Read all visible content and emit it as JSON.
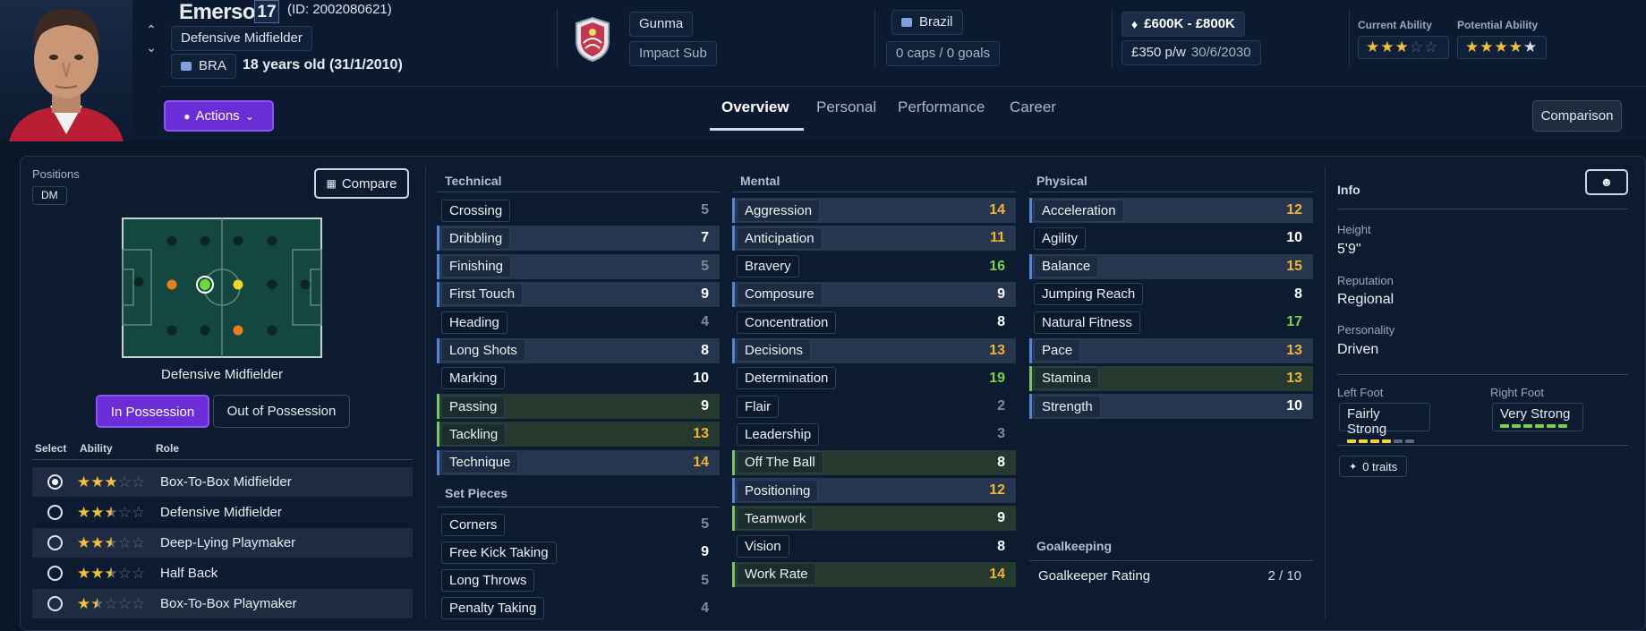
{
  "player": {
    "name": "Emerson",
    "shirt_number": "17",
    "id_text": "(ID: 2002080621)",
    "position_label": "Defensive Midfielder",
    "nationality_code": "BRA",
    "age_text": "18 years old (31/1/2010)"
  },
  "club": {
    "name": "Gunma",
    "squad_status": "Impact Sub"
  },
  "international": {
    "country": "Brazil",
    "caps_goals": "0 caps / 0 goals"
  },
  "contract": {
    "value": "£600K - £800K",
    "wage": "£350 p/w",
    "expiry": "30/6/2030"
  },
  "ability": {
    "current_label": "Current Ability",
    "current_stars": 3,
    "potential_label": "Potential Ability",
    "potential_stars": 5
  },
  "toolbar": {
    "actions_label": "Actions",
    "comparison_label": "Comparison"
  },
  "tabs": [
    {
      "label": "Overview",
      "active": true
    },
    {
      "label": "Personal",
      "active": false
    },
    {
      "label": "Performance",
      "active": false
    },
    {
      "label": "Career",
      "active": false
    }
  ],
  "positions": {
    "title": "Positions",
    "badge": "DM",
    "compare_label": "Compare",
    "pitch_caption": "Defensive Midfielder",
    "in_possession_label": "In Possession",
    "out_possession_label": "Out of Possession",
    "headers": {
      "select": "Select",
      "ability": "Ability",
      "role": "Role"
    },
    "roles": [
      {
        "name": "Box-To-Box Midfielder",
        "stars": 3,
        "selected": true
      },
      {
        "name": "Defensive Midfielder",
        "stars": 2.5,
        "selected": false
      },
      {
        "name": "Deep-Lying Playmaker",
        "stars": 2.5,
        "selected": false
      },
      {
        "name": "Half Back",
        "stars": 2.5,
        "selected": false
      },
      {
        "name": "Box-To-Box Playmaker",
        "stars": 1.5,
        "selected": false
      }
    ]
  },
  "technical": {
    "title": "Technical",
    "attrs": [
      {
        "name": "Crossing",
        "value": "5",
        "color": "#7f8b9c",
        "hl": ""
      },
      {
        "name": "Dribbling",
        "value": "7",
        "color": "#ffffff",
        "hl": "blue"
      },
      {
        "name": "Finishing",
        "value": "5",
        "color": "#7f8b9c",
        "hl": "blue"
      },
      {
        "name": "First Touch",
        "value": "9",
        "color": "#ffffff",
        "hl": "blue"
      },
      {
        "name": "Heading",
        "value": "4",
        "color": "#7f8b9c",
        "hl": ""
      },
      {
        "name": "Long Shots",
        "value": "8",
        "color": "#ffffff",
        "hl": "blue"
      },
      {
        "name": "Marking",
        "value": "10",
        "color": "#ffffff",
        "hl": ""
      },
      {
        "name": "Passing",
        "value": "9",
        "color": "#ffffff",
        "hl": "green"
      },
      {
        "name": "Tackling",
        "value": "13",
        "color": "#f2b233",
        "hl": "green"
      },
      {
        "name": "Technique",
        "value": "14",
        "color": "#f2b233",
        "hl": "blue"
      }
    ]
  },
  "set_pieces": {
    "title": "Set Pieces",
    "attrs": [
      {
        "name": "Corners",
        "value": "5",
        "color": "#7f8b9c",
        "hl": ""
      },
      {
        "name": "Free Kick Taking",
        "value": "9",
        "color": "#ffffff",
        "hl": ""
      },
      {
        "name": "Long Throws",
        "value": "5",
        "color": "#7f8b9c",
        "hl": ""
      },
      {
        "name": "Penalty Taking",
        "value": "4",
        "color": "#7f8b9c",
        "hl": ""
      }
    ]
  },
  "mental": {
    "title": "Mental",
    "attrs": [
      {
        "name": "Aggression",
        "value": "14",
        "color": "#f2b233",
        "hl": "blue"
      },
      {
        "name": "Anticipation",
        "value": "11",
        "color": "#f2b233",
        "hl": "blue"
      },
      {
        "name": "Bravery",
        "value": "16",
        "color": "#79d04a",
        "hl": ""
      },
      {
        "name": "Composure",
        "value": "9",
        "color": "#ffffff",
        "hl": "blue"
      },
      {
        "name": "Concentration",
        "value": "8",
        "color": "#ffffff",
        "hl": ""
      },
      {
        "name": "Decisions",
        "value": "13",
        "color": "#f2b233",
        "hl": "blue"
      },
      {
        "name": "Determination",
        "value": "19",
        "color": "#79d04a",
        "hl": ""
      },
      {
        "name": "Flair",
        "value": "2",
        "color": "#7f8b9c",
        "hl": ""
      },
      {
        "name": "Leadership",
        "value": "3",
        "color": "#7f8b9c",
        "hl": ""
      },
      {
        "name": "Off The Ball",
        "value": "8",
        "color": "#ffffff",
        "hl": "green"
      },
      {
        "name": "Positioning",
        "value": "12",
        "color": "#f2b233",
        "hl": "blue"
      },
      {
        "name": "Teamwork",
        "value": "9",
        "color": "#ffffff",
        "hl": "green"
      },
      {
        "name": "Vision",
        "value": "8",
        "color": "#ffffff",
        "hl": ""
      },
      {
        "name": "Work Rate",
        "value": "14",
        "color": "#f2b233",
        "hl": "green"
      }
    ]
  },
  "physical": {
    "title": "Physical",
    "attrs": [
      {
        "name": "Acceleration",
        "value": "12",
        "color": "#f2b233",
        "hl": "blue"
      },
      {
        "name": "Agility",
        "value": "10",
        "color": "#ffffff",
        "hl": ""
      },
      {
        "name": "Balance",
        "value": "15",
        "color": "#f2b233",
        "hl": "blue"
      },
      {
        "name": "Jumping Reach",
        "value": "8",
        "color": "#ffffff",
        "hl": ""
      },
      {
        "name": "Natural Fitness",
        "value": "17",
        "color": "#79d04a",
        "hl": ""
      },
      {
        "name": "Pace",
        "value": "13",
        "color": "#f2b233",
        "hl": "blue"
      },
      {
        "name": "Stamina",
        "value": "13",
        "color": "#f2b233",
        "hl": "green"
      },
      {
        "name": "Strength",
        "value": "10",
        "color": "#ffffff",
        "hl": "blue"
      }
    ]
  },
  "goalkeeping": {
    "title": "Goalkeeping",
    "rating_label": "Goalkeeper Rating",
    "rating_value": "2 / 10"
  },
  "info": {
    "title": "Info",
    "height_label": "Height",
    "height": "5'9\"",
    "reputation_label": "Reputation",
    "reputation": "Regional",
    "personality_label": "Personality",
    "personality": "Driven",
    "left_foot_label": "Left Foot",
    "left_foot": "Fairly Strong",
    "left_foot_level": 4,
    "right_foot_label": "Right Foot",
    "right_foot": "Very Strong",
    "right_foot_level": 6,
    "traits_label": "0 traits"
  },
  "colors": {
    "accent_purple": "#6b2ed6",
    "attr_yellow": "#f2b233",
    "attr_green": "#79d04a",
    "attr_grey": "#7f8b9c"
  }
}
